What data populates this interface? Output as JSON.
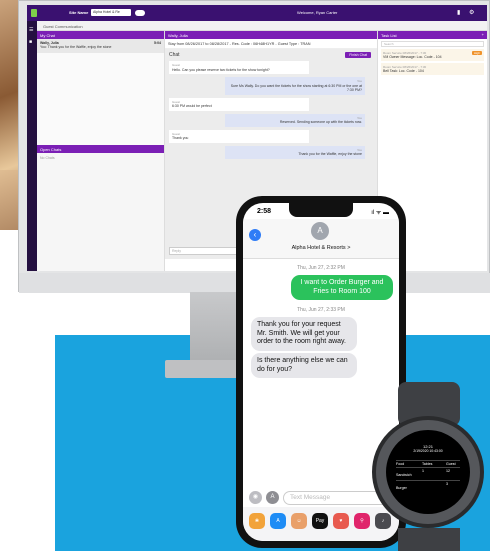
{
  "monitor": {
    "site_label": "Site Name",
    "site_select": "Alpha Hotel & Re",
    "welcome": "Welcome, Ryan Carter",
    "section_title": "Guest Communication",
    "my_chat": {
      "header": "My Chat",
      "contact_name": "Wally, Julia",
      "contact_time": "5:04",
      "contact_preview": "You: Thank you for the Waffle, enjoy the stone",
      "open_chats_header": "Open Chats",
      "open_chats_empty": "No Chats"
    },
    "chat": {
      "header": "Wally, Julia",
      "stay_info": "Stay from 08/26/2017 to 08/28/2017 - Res. Code : 06H48H1YR - Guest Type : TRAN",
      "title": "Chat",
      "close_button": "Finish Chat",
      "messages": [
        {
          "who": "Guest",
          "text": "Hello. Can you please reserve two tickets for the show tonight?",
          "dir": "in"
        },
        {
          "who": "You",
          "text": "Sure Ms Wally. Do you want the tickets for the show starting at 6:30 PM or the one at 7:30 PM?",
          "dir": "out"
        },
        {
          "who": "Guest",
          "text": "6:30 PM would be perfect",
          "dir": "in"
        },
        {
          "who": "You",
          "text": "Reserved. Sending someone up with the tickets now.",
          "dir": "out"
        },
        {
          "who": "Guest",
          "text": "Thank you",
          "dir": "in"
        },
        {
          "who": "You",
          "text": "Thank you for the Waffle, enjoy the stone",
          "dir": "out"
        }
      ],
      "reply_placeholder": "Reply"
    },
    "tasks": {
      "header": "Task List",
      "search_placeholder": "Search",
      "items": [
        {
          "when": "Room Service 08/26/2017 - 7:30",
          "text": "VM Owner Message: Loc. Code - 104",
          "priority": "High"
        },
        {
          "when": "Room Service 08/26/2017 - 7:30",
          "text": "Bell Task: Loc. Code - 104",
          "priority": ""
        }
      ]
    }
  },
  "phone": {
    "time": "2:58",
    "status": "ıl ᯤ ▬",
    "back_icon": "chevron-left-icon",
    "avatar_letter": "A",
    "contact": "Alpha Hotel & Resorts >",
    "timestamp_1": "Thu, Jun 27, 2:32 PM",
    "sent_message": "I want to Order Burger and Fries to Room 100",
    "timestamp_2": "Thu, Jun 27, 2:33 PM",
    "reply_1": "Thank you for your request Mr. Smith. We will get your order to the room right away.",
    "reply_2": "Is there anything else we can do for you?",
    "input_placeholder": "Text Message"
  },
  "watch": {
    "time": "12:21",
    "date": "2/19/2020 10:43:00",
    "headers": [
      "Food",
      "Tables",
      "Guest"
    ],
    "rows": [
      [
        "Sandwich",
        "1",
        "12"
      ],
      [
        "Burger",
        "",
        "3"
      ]
    ]
  },
  "colors": {
    "purple": "#7b1fb5",
    "sent_bubble": "#2bc25c",
    "backdrop": "#1aa3de"
  }
}
